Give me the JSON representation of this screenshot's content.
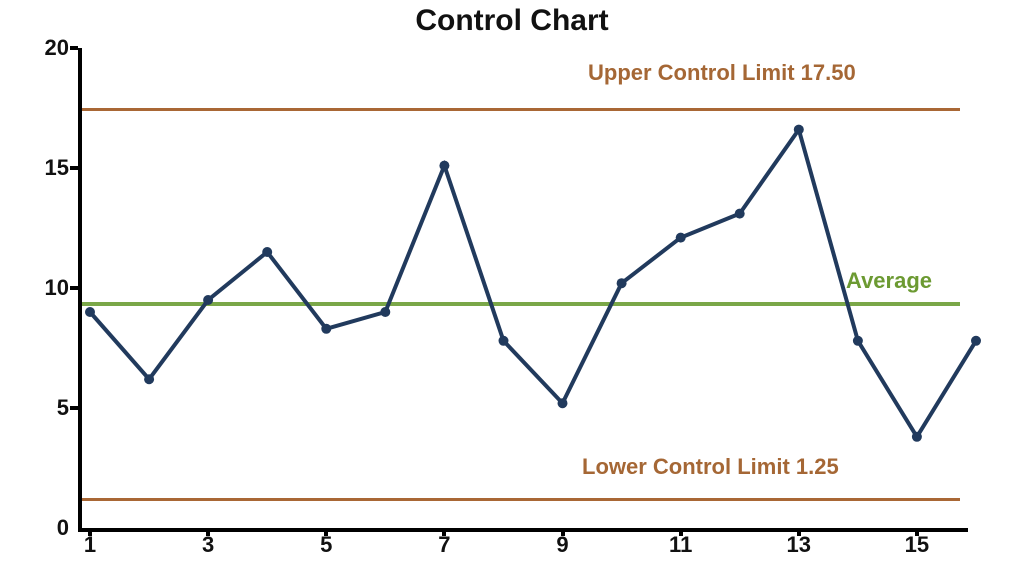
{
  "chart_data": {
    "type": "line",
    "title": "Control Chart",
    "xlabel": "",
    "ylabel": "",
    "categories": [
      1,
      2,
      3,
      4,
      5,
      6,
      7,
      8,
      9,
      10,
      11,
      12,
      13,
      14,
      15,
      16
    ],
    "values": [
      9.0,
      6.2,
      9.5,
      11.5,
      8.3,
      9.0,
      15.1,
      7.8,
      5.2,
      10.2,
      12.1,
      13.1,
      16.6,
      7.8,
      3.8,
      7.8
    ],
    "xlim": [
      1,
      16
    ],
    "ylim": [
      0,
      20
    ],
    "y_ticks": [
      0,
      5,
      10,
      15,
      20
    ],
    "x_ticks": [
      1,
      3,
      5,
      7,
      9,
      11,
      13,
      15
    ],
    "reference_lines": {
      "upper_control_limit": 17.5,
      "average": 9.4,
      "lower_control_limit": 1.25
    }
  },
  "labels": {
    "title": "Control Chart",
    "ucl": "Upper Control Limit",
    "ucl_val": "17.50",
    "lcl": "Lower Control Limit",
    "lcl_val": "1.25",
    "avg": "Average"
  },
  "y_ticks_str": {
    "0": "0",
    "1": "5",
    "2": "10",
    "3": "15",
    "4": "20"
  },
  "x_ticks_str": {
    "0": "1",
    "1": "3",
    "2": "5",
    "3": "7",
    "4": "9",
    "5": "11",
    "6": "13",
    "7": "15"
  },
  "colors": {
    "series": "#213a5d",
    "limit": "#a96735",
    "avg": "#7aa748"
  }
}
